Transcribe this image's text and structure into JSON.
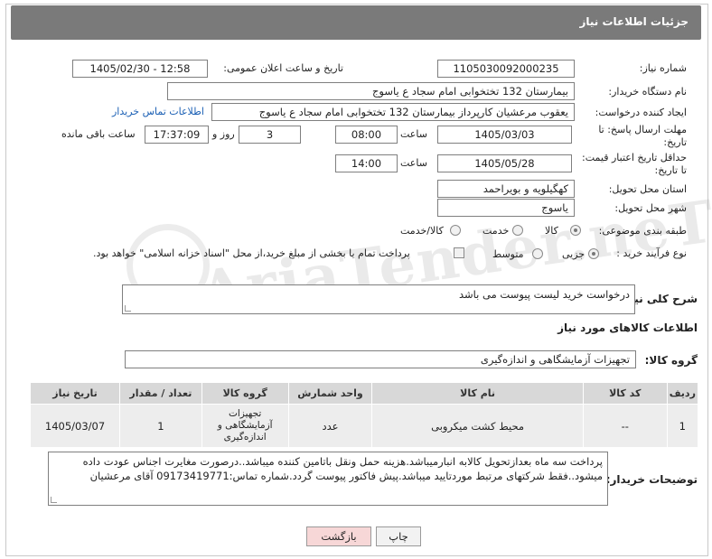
{
  "header": {
    "title": "جزئیات اطلاعات نیاز"
  },
  "watermark": "AriaTender.neT",
  "fields": {
    "need_number_label": "شماره نیاز:",
    "need_number": "1105030092000235",
    "announce_label": "تاریخ و ساعت اعلان عمومی:",
    "announce_value": "1405/02/30 - 12:58",
    "buyer_org_label": "نام دستگاه خریدار:",
    "buyer_org": "بیمارستان 132 تختخوابی امام سجاد  ع  یاسوج",
    "creator_label": "ایجاد کننده درخواست:",
    "creator": "یعقوب مرعشیان کارپرداز بیمارستان 132 تختخوابی امام سجاد  ع  یاسوج",
    "contact_link": "اطلاعات تماس خریدار",
    "deadline_label_1": "مهلت ارسال پاسخ: تا",
    "deadline_label_2": "تاریخ:",
    "deadline_date": "1405/03/03",
    "time_label": "ساعت",
    "deadline_time": "08:00",
    "days_value": "3",
    "days_label": "روز و",
    "remaining_time": "17:37:09",
    "remaining_label": "ساعت باقی مانده",
    "min_price_label_1": "حداقل تاریخ اعتبار قیمت:",
    "min_price_label_2": "تا تاریخ:",
    "price_date": "1405/05/28",
    "price_time_label": "ساعت",
    "price_time": "14:00",
    "province_label": "استان محل تحویل:",
    "province": "کهگیلویه و بویراحمد",
    "city_label": "شهر محل تحویل:",
    "city": "یاسوج",
    "category_label": "طبقه بندی موضوعی:",
    "category_options": [
      "کالا",
      "خدمت",
      "کالا/خدمت"
    ],
    "category_selected": "کالا",
    "process_label": "نوع فرآیند خرید :",
    "process_options": [
      "جزیی",
      "متوسط"
    ],
    "process_selected": "جزیی",
    "payment_note": "پرداخت تمام یا بخشی از مبلغ خرید،از محل \"اسناد خزانه اسلامی\" خواهد بود."
  },
  "description": {
    "label": "شرح کلی نیاز:",
    "value": "درخواست خرید لیست پیوست می باشد"
  },
  "goods_section": {
    "title": "اطلاعات کالاهای مورد نیاز",
    "group_label": "گروه کالا:",
    "group_value": "تجهیزات آزمایشگاهی و اندازه‌گیری"
  },
  "table": {
    "headers": [
      "ردیف",
      "کد کالا",
      "نام کالا",
      "واحد شمارش",
      "گروه کالا",
      "تعداد / مقدار",
      "تاریخ نیاز"
    ],
    "rows": [
      [
        "1",
        "--",
        "محیط کشت میکروبی",
        "عدد",
        "تجهیزات آزمایشگاهی و اندازه‌گیری",
        "1",
        "1405/03/07"
      ]
    ]
  },
  "buyer_notes": {
    "label": "توضیحات خریدار:",
    "value": "پرداخت سه ماه بعدازتحویل کالابه انبارمیباشد.هزینه حمل ونقل باتامین کننده میباشد..درصورت مغایرت اجناس عودت داده میشود..فقط شرکتهای مرتبط موردتایید میباشد.پیش فاکتور پیوست گردد.شماره تماس:09173419771 آقای مرعشیان"
  },
  "buttons": {
    "print": "چاپ",
    "back": "بازگشت"
  },
  "colors": {
    "titlebar": "#7a7a7a",
    "link": "#1a5fb4",
    "table_header": "#d8d8d8",
    "table_row": "#ededed",
    "back_button": "#f7d7d7"
  }
}
